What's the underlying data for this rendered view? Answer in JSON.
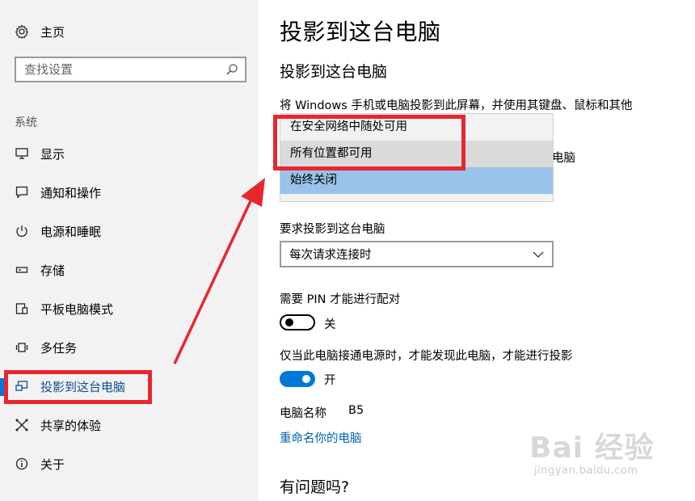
{
  "sidebar": {
    "home_label": "主页",
    "search_placeholder": "查找设置",
    "section_label": "系统",
    "items": [
      {
        "label": "显示",
        "icon": "monitor-icon"
      },
      {
        "label": "通知和操作",
        "icon": "message-icon"
      },
      {
        "label": "电源和睡眠",
        "icon": "power-icon"
      },
      {
        "label": "存储",
        "icon": "storage-icon"
      },
      {
        "label": "平板电脑模式",
        "icon": "tablet-icon"
      },
      {
        "label": "多任务",
        "icon": "multitask-icon"
      },
      {
        "label": "投影到这台电脑",
        "icon": "project-icon",
        "active": true
      },
      {
        "label": "共享的体验",
        "icon": "share-icon"
      },
      {
        "label": "关于",
        "icon": "info-icon"
      }
    ]
  },
  "main": {
    "page_title": "投影到这台电脑",
    "section_title": "投影到这台电脑",
    "description": "将 Windows 手机或电脑投影到此屏幕，并使用其键盘、鼠标和其他",
    "description_tail": "电脑",
    "availability_options": [
      "在安全网络中随处可用",
      "所有位置都可用",
      "始终关闭"
    ],
    "availability_selected": "始终关闭",
    "ask_label": "要求投影到这台电脑",
    "ask_value": "每次请求连接时",
    "pin_label": "需要 PIN 才能进行配对",
    "pin_state": "关",
    "power_label": "仅当此电脑接通电源时，才能发现此电脑，才能进行投影",
    "power_state": "开",
    "pc_name_label": "电脑名称",
    "pc_name_value": "B5",
    "rename_link": "重命名你的电脑",
    "faq_title": "有问题吗?"
  },
  "colors": {
    "accent": "#0078d7",
    "annotation_red": "#e8262f",
    "link": "#0063b1"
  },
  "watermark": {
    "logo_text": "Bai 经验",
    "url": "jingyan.baidu.com"
  }
}
